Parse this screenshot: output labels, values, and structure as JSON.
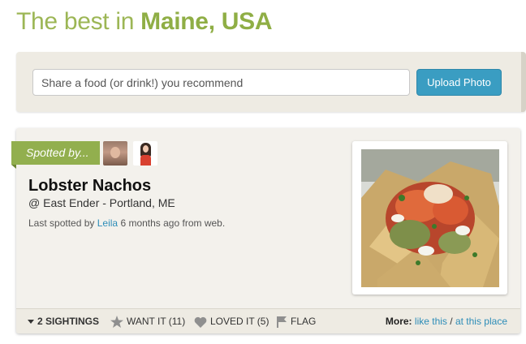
{
  "heading": {
    "prefix": "The best in",
    "place": "Maine, USA"
  },
  "share": {
    "placeholder": "Share a food (or drink!) you recommend",
    "upload_label": "Upload Photo"
  },
  "card": {
    "ribbon_label": "Spotted by...",
    "avatars": [
      "avatar-icon",
      "avatar-icon"
    ],
    "dish_name": "Lobster Nachos",
    "place": "@ East Ender - Portland, ME",
    "last_spotted_prefix": "Last spotted by",
    "last_spotted_user": "Leila",
    "last_spotted_suffix": "6 months ago from web.",
    "footer": {
      "sightings": "2 SIGHTINGS",
      "want_it": "WANT IT (11)",
      "loved_it": "LOVED IT (5)",
      "flag": "FLAG",
      "more_label": "More:",
      "like_this": "like this",
      "separator": "/",
      "at_this_place": "at this place"
    }
  },
  "colors": {
    "accent_green": "#92af4e",
    "heading_green": "#9cb655",
    "button_blue": "#3a9dc2",
    "link_blue": "#2d8db8"
  }
}
